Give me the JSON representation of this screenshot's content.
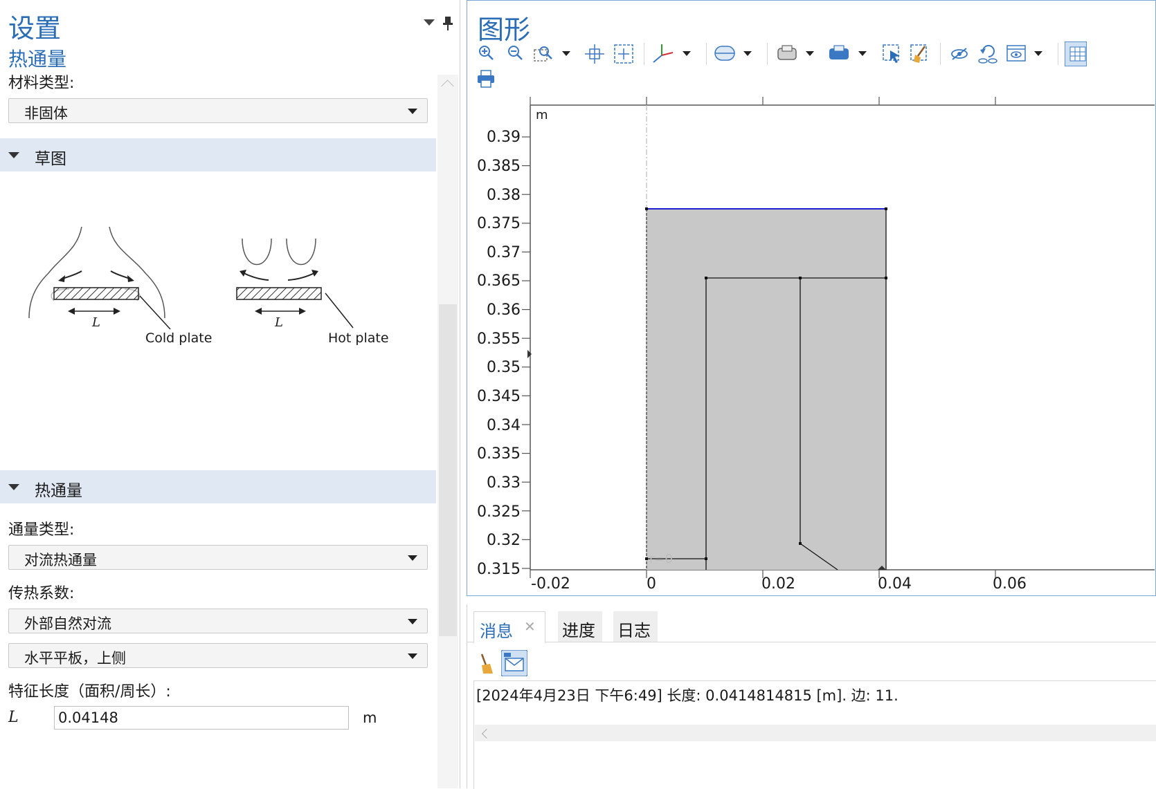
{
  "settings": {
    "title": "设置",
    "subtitle": "热通量",
    "material_type_label": "材料类型:",
    "material_type_value": "非固体",
    "sketch_section": "草图",
    "sketch": {
      "left_caption": "Cold plate",
      "right_caption": "Hot plate",
      "length_symbol": "L"
    },
    "heat_flux_section": "热通量",
    "flux_type_label": "通量类型:",
    "flux_type_value": "对流热通量",
    "htc_label": "传热系数:",
    "htc_value": "外部自然对流",
    "orientation_value": "水平平板，上侧",
    "char_length_label": "特征长度（面积/周长）:",
    "char_length_symbol": "L",
    "char_length_value": "0.04148",
    "char_length_unit": "m"
  },
  "graphics": {
    "title": "图形",
    "toolbar_icons": [
      "zoom-in-icon",
      "zoom-out-icon",
      "zoom-box-icon",
      "zoom-extents-icon",
      "center-icon",
      "axis-orientation-icon",
      "clip-icon",
      "geometry-view-icon",
      "select-mode-icon",
      "select-box-icon",
      "clear-selection-icon",
      "hide-icon",
      "reset-hiding-icon",
      "view-icon",
      "grid-icon",
      "print-icon"
    ],
    "axis_unit": "m",
    "y_ticks": [
      "0.39",
      "0.385",
      "0.38",
      "0.375",
      "0.37",
      "0.365",
      "0.36",
      "0.355",
      "0.35",
      "0.345",
      "0.34",
      "0.335",
      "0.33",
      "0.325",
      "0.32",
      "0.315"
    ],
    "x_ticks": [
      "-0.02",
      "0",
      "0.02",
      "0.04",
      "0.06"
    ],
    "axis_annotation": "r=0",
    "colors": {
      "domain_fill": "#c8c8c8",
      "selected_edge": "#1f1fd0",
      "accent": "#2a6db6"
    }
  },
  "messages": {
    "tabs": [
      {
        "label": "消息",
        "active": true
      },
      {
        "label": "进度",
        "active": false
      },
      {
        "label": "日志",
        "active": false
      }
    ],
    "close_glyph": "✕",
    "log_line": "[2024年4月23日 下午6:49] 长度: 0.0414814815 [m]. 边: 11."
  }
}
